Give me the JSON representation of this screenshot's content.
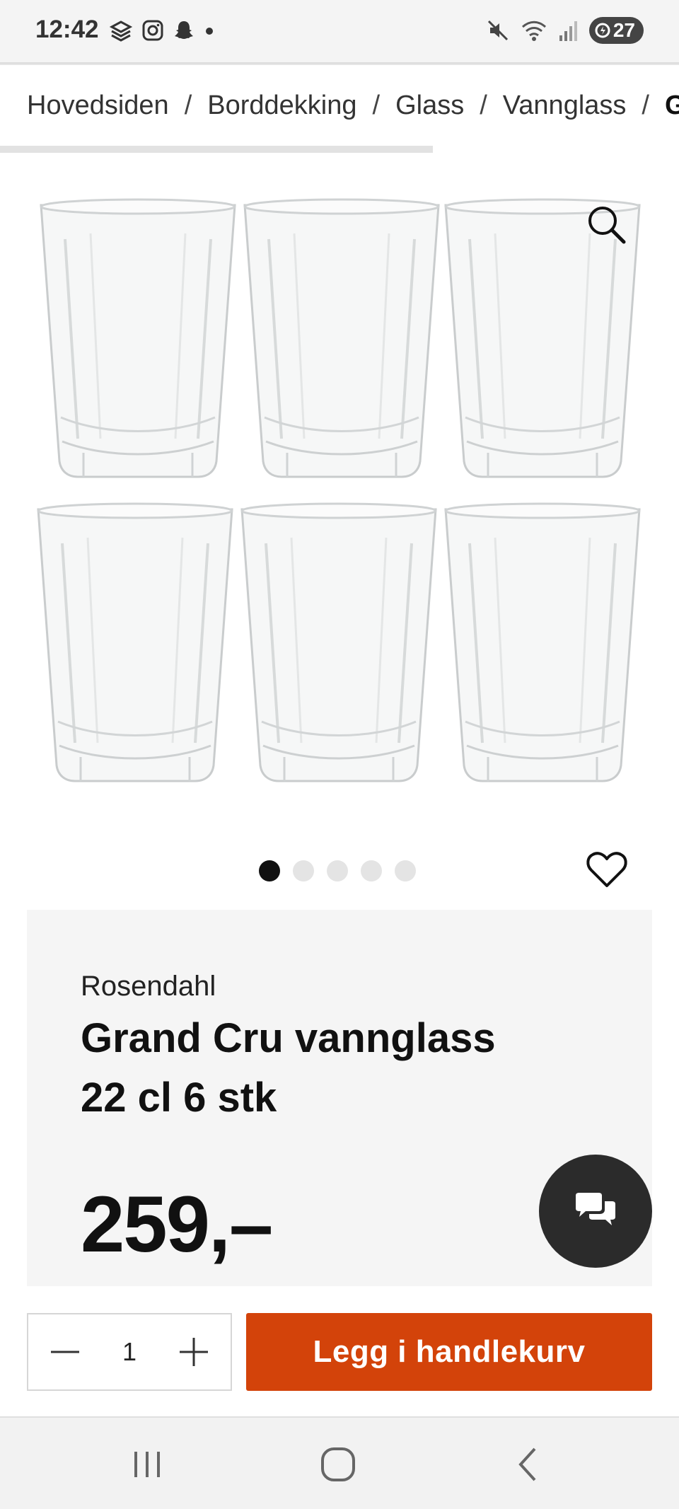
{
  "status_bar": {
    "time": "12:42",
    "battery": "27",
    "icons": [
      "notification-stack-icon",
      "instagram-icon",
      "snapchat-icon",
      "dot-icon",
      "mute-icon",
      "wifi-icon",
      "signal-icon",
      "battery-icon"
    ]
  },
  "breadcrumb": {
    "items": [
      "Hovedsiden",
      "Borddekking",
      "Glass",
      "Vannglass"
    ],
    "current": "Gra",
    "separator": "/"
  },
  "gallery": {
    "dots_count": 5,
    "active_dot": 1
  },
  "product": {
    "brand": "Rosendahl",
    "title": "Grand Cru vannglass 22 cl 6 stk",
    "price": "259,–"
  },
  "cart": {
    "quantity": "1",
    "add_label": "Legg i handlekurv",
    "accent_color": "#d3430a"
  }
}
